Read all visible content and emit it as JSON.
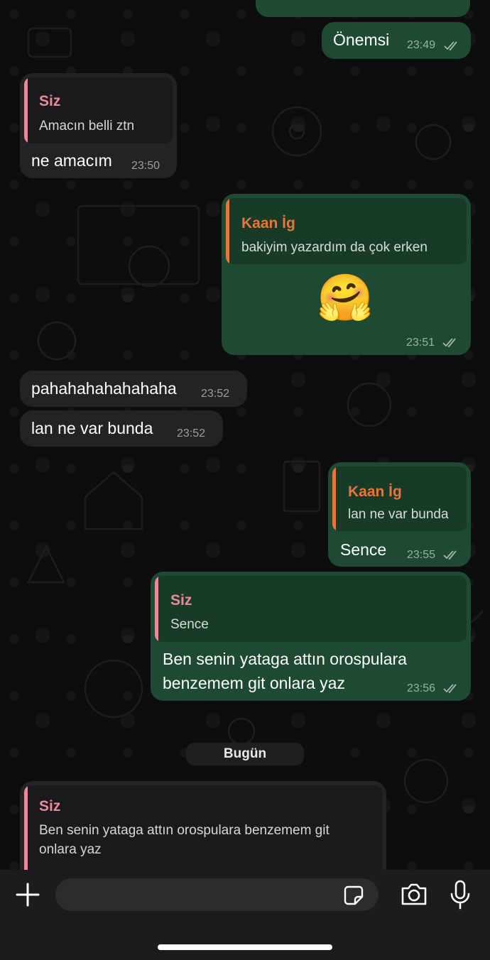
{
  "messages": [
    {
      "id": "m0",
      "text": "Önemsi",
      "time": "23:49"
    },
    {
      "id": "m1",
      "quote_name": "Siz",
      "quote_text": "Amacın belli ztn",
      "text": "ne amacım",
      "time": "23:50"
    },
    {
      "id": "m2",
      "quote_name": "Kaan İg",
      "quote_text": "bakiyim yazardım da çok erken",
      "text": "🤗",
      "time": "23:51"
    },
    {
      "id": "m3",
      "text": "pahahahahahahaha",
      "time": "23:52"
    },
    {
      "id": "m4",
      "text": "lan ne var bunda",
      "time": "23:52"
    },
    {
      "id": "m5",
      "quote_name": "Kaan İg",
      "quote_text": "lan ne var bunda",
      "text": "Sence",
      "time": "23:55"
    },
    {
      "id": "m6",
      "quote_name": "Siz",
      "quote_text": "Sence",
      "text_line1": "Ben senin yataga attın orospulara",
      "text_line2": "benzemem git onlara yaz",
      "time": "23:56"
    }
  ],
  "date_separator": "Bugün",
  "reply_preview": {
    "name": "Siz",
    "line1": "Ben senin yataga attın orospulara benzemem git",
    "line2": "onlara yaz"
  },
  "composer": {
    "icons": [
      "plus-icon",
      "sticker-icon",
      "camera-icon",
      "microphone-icon"
    ]
  },
  "colors": {
    "outgoing_bubble": "#1e4a33",
    "incoming_bubble": "#232326",
    "siz_accent": "#e98a9a",
    "kaan_accent": "#e8753a"
  }
}
